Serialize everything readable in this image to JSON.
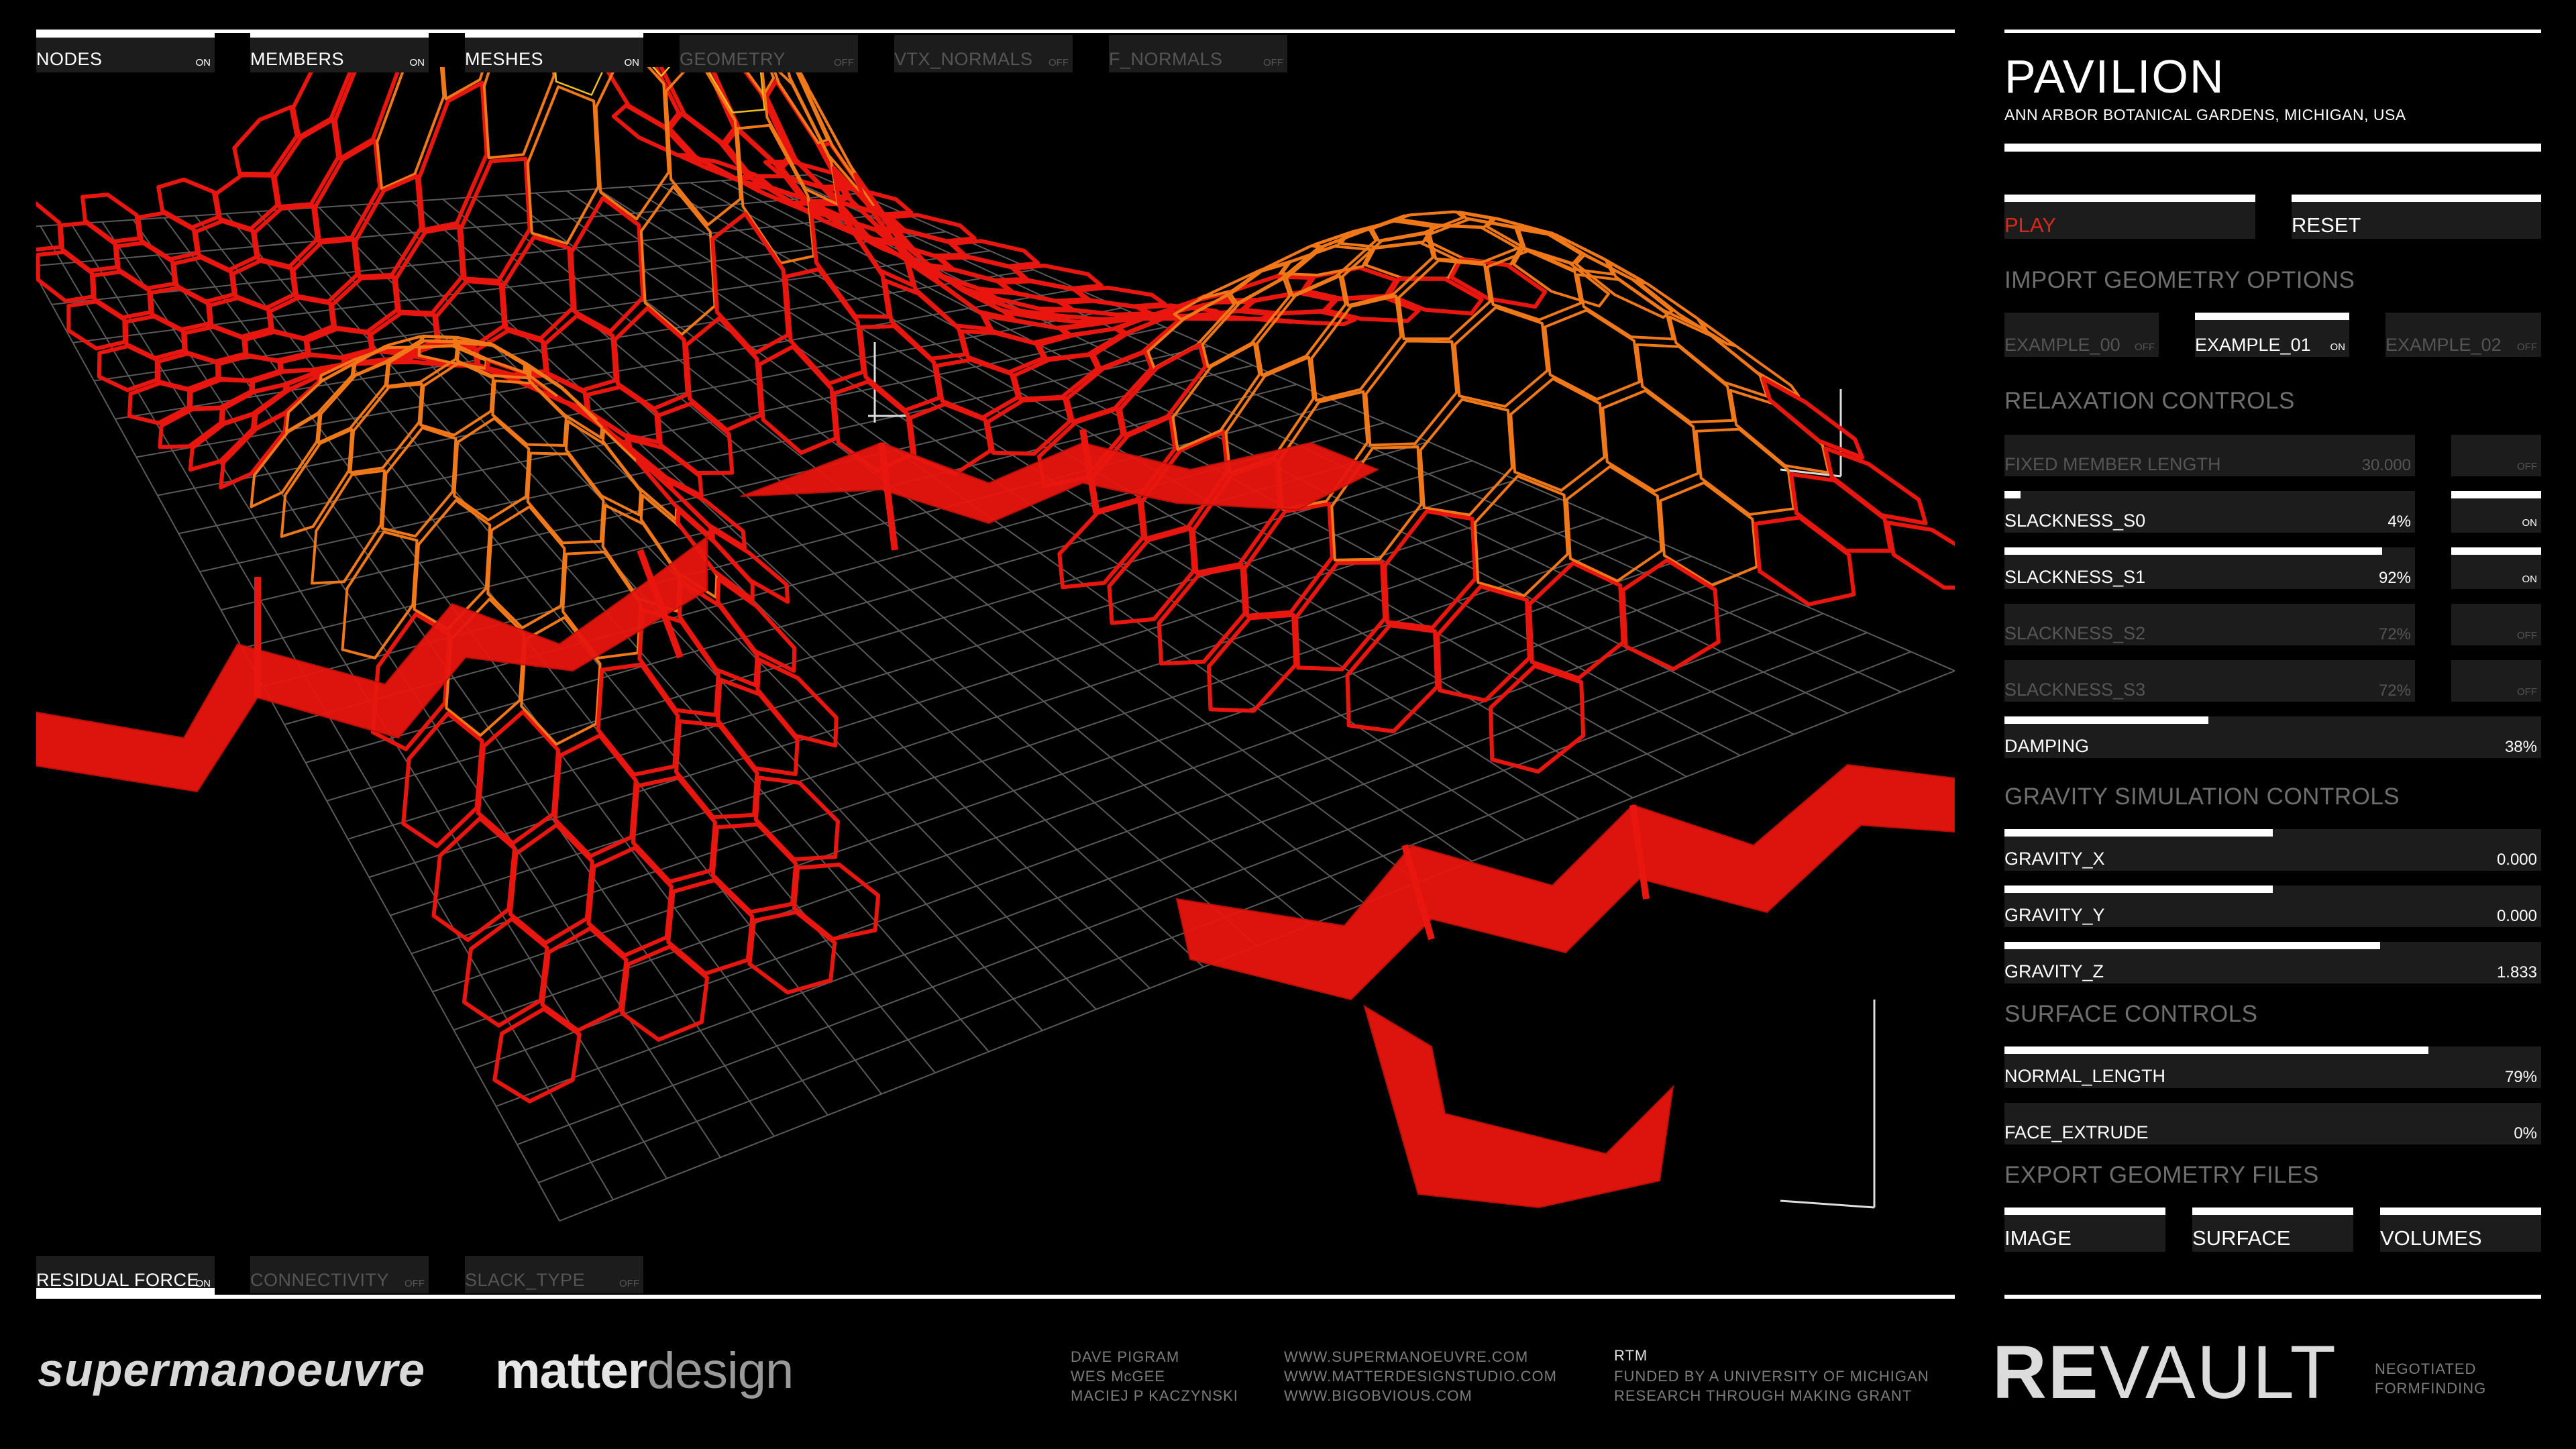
{
  "top_toggles": [
    {
      "label": "NODES",
      "state": "ON",
      "on": true
    },
    {
      "label": "MEMBERS",
      "state": "ON",
      "on": true
    },
    {
      "label": "MESHES",
      "state": "ON",
      "on": true
    },
    {
      "label": "GEOMETRY",
      "state": "OFF",
      "on": false
    },
    {
      "label": "VTX_NORMALS",
      "state": "OFF",
      "on": false
    },
    {
      "label": "F_NORMALS",
      "state": "OFF",
      "on": false
    }
  ],
  "bottom_toggles": [
    {
      "label": "RESIDUAL FORCE",
      "state": "ON",
      "on": true
    },
    {
      "label": "CONNECTIVITY",
      "state": "OFF",
      "on": false
    },
    {
      "label": "SLACK_TYPE",
      "state": "OFF",
      "on": false
    }
  ],
  "project": {
    "title": "PAVILION",
    "location": "ANN ARBOR BOTANICAL GARDENS, MICHIGAN, USA"
  },
  "playback": {
    "play_label": "PLAY",
    "reset_label": "RESET"
  },
  "import": {
    "heading": "IMPORT GEOMETRY OPTIONS",
    "options": [
      {
        "label": "EXAMPLE_00",
        "state": "OFF",
        "on": false
      },
      {
        "label": "EXAMPLE_01",
        "state": "ON",
        "on": true
      },
      {
        "label": "EXAMPLE_02",
        "state": "OFF",
        "on": false
      }
    ]
  },
  "relaxation": {
    "heading": "RELAXATION CONTROLS",
    "sliders": [
      {
        "label": "FIXED MEMBER LENGTH",
        "value": "30.000",
        "level": 0,
        "toggle": "OFF",
        "enabled": false
      },
      {
        "label": "SLACKNESS_S0",
        "value": "4%",
        "level": 0.04,
        "toggle": "ON",
        "enabled": true
      },
      {
        "label": "SLACKNESS_S1",
        "value": "92%",
        "level": 0.92,
        "toggle": "ON",
        "enabled": true
      },
      {
        "label": "SLACKNESS_S2",
        "value": "72%",
        "level": 0,
        "toggle": "OFF",
        "enabled": false
      },
      {
        "label": "SLACKNESS_S3",
        "value": "72%",
        "level": 0,
        "toggle": "OFF",
        "enabled": false
      }
    ],
    "damping": {
      "label": "DAMPING",
      "value": "38%",
      "level": 0.38
    }
  },
  "gravity": {
    "heading": "GRAVITY SIMULATION CONTROLS",
    "sliders": [
      {
        "label": "GRAVITY_X",
        "value": "0.000",
        "level": 0.5
      },
      {
        "label": "GRAVITY_Y",
        "value": "0.000",
        "level": 0.5
      },
      {
        "label": "GRAVITY_Z",
        "value": "1.833",
        "level": 0.7
      }
    ]
  },
  "surface": {
    "heading": "SURFACE CONTROLS",
    "sliders": [
      {
        "label": "NORMAL_LENGTH",
        "value": "79%",
        "level": 0.79
      },
      {
        "label": "FACE_EXTRUDE",
        "value": "0%",
        "level": 0
      }
    ]
  },
  "export": {
    "heading": "EXPORT GEOMETRY FILES",
    "buttons": [
      "IMAGE",
      "SURFACE",
      "VOLUMES"
    ]
  },
  "footer": {
    "logo_a": "supermanoeuvre",
    "logo_b1": "matter",
    "logo_b2": "design",
    "people": "DAVE PIGRAM\nWES McGEE\nMACIEJ P KACZYNSKI",
    "sites": "WWW.SUPERMANOEUVRE.COM\nWWW.MATTERDESIGNSTUDIO.COM\nWWW.BIGOBVIOUS.COM",
    "rtm_title": "RTM",
    "rtm_text": "FUNDED BY A UNIVERSITY OF MICHIGAN\nRESEARCH THROUGH MAKING GRANT",
    "brand_a": "RE",
    "brand_b": "VAULT",
    "tagline": "NEGOTIATED\nFORMFINDING"
  },
  "colors": {
    "accent_red": "#e8160e",
    "mesh_orange": "#f07818",
    "mesh_yellow": "#f0c020",
    "panel_bg": "#1c1c1c",
    "dim_text": "#6e6e6e",
    "play_red": "#d8281c"
  }
}
